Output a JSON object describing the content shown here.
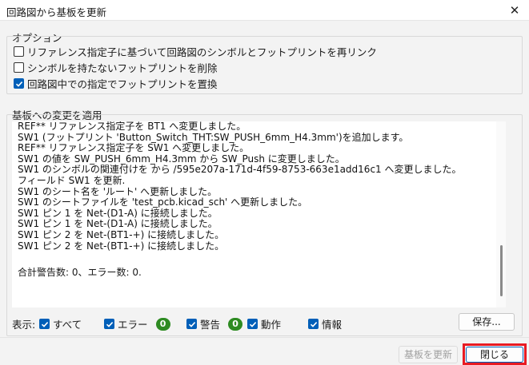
{
  "window": {
    "title": "回路図から基板を更新",
    "close_glyph": "✕"
  },
  "options": {
    "group_label": "オプション",
    "items": [
      {
        "label": "リファレンス指定子に基づいて回路図のシンボルとフットプリントを再リンク",
        "checked": false
      },
      {
        "label": "シンボルを持たないフットプリントを削除",
        "checked": false
      },
      {
        "label": "回路図中での指定でフットプリントを置換",
        "checked": true
      }
    ]
  },
  "changes": {
    "group_label": "基板への変更を適用",
    "lines": [
      "REF** リファレンス指定子を BT1 へ変更しました。",
      "SW1 (フットプリント 'Button_Switch_THT:SW_PUSH_6mm_H4.3mm')を追加します。",
      "REF** リファレンス指定子を SW1 へ変更しました。",
      "SW1 の値を SW_PUSH_6mm_H4.3mm から SW_Push に変更しました。",
      "SW1 のシンボルの関連付けを から /595e207a-171d-4f59-8753-663e1add16c1 へ変更しました。",
      "フィールド SW1 を更新.",
      "SW1 のシート名を 'ルート' へ更新しました。",
      "SW1 のシートファイルを 'test_pcb.kicad_sch' へ更新しました。",
      "SW1 ピン 1 を Net-(D1-A) に接続しました。",
      "SW1 ピン 1 を Net-(D1-A) に接続しました。",
      "SW1 ピン 2 を Net-(BT1-+) に接続しました。",
      "SW1 ピン 2 を Net-(BT1-+) に接続しました。"
    ],
    "summary": "合計警告数: 0、エラー数: 0."
  },
  "filters": {
    "label": "表示:",
    "all": "すべて",
    "errors": "エラー",
    "errors_count": "0",
    "warnings": "警告",
    "warnings_count": "0",
    "actions": "動作",
    "info": "情報",
    "save_button": "保存..."
  },
  "footer": {
    "update_button": "基板を更新",
    "close_button": "閉じる"
  },
  "colors": {
    "accent": "#005fb8",
    "badge": "#2e8b22",
    "highlight": "#e81b23"
  }
}
